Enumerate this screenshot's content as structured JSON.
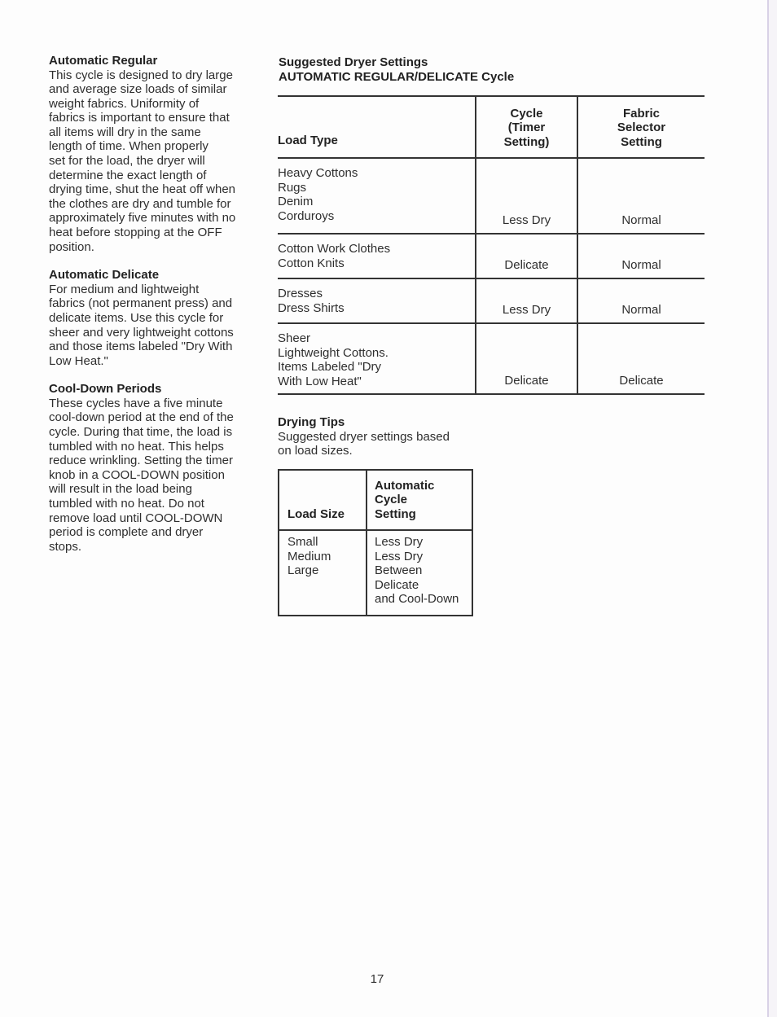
{
  "left_column": {
    "sections": [
      {
        "title": "Automatic Regular",
        "lines": [
          "This cycle is designed to dry large",
          "and average size loads of similar",
          "weight fabrics. Uniformity of",
          "fabrics is important to ensure that",
          "all items will dry in the same",
          "length of time. When properly",
          "set for the load, the dryer will",
          "determine the exact length of",
          "drying time, shut the heat off when",
          "the clothes are dry and tumble for",
          "approximately five minutes with no",
          "heat before stopping at the OFF",
          "position."
        ]
      },
      {
        "title": "Automatic Delicate",
        "lines": [
          "For medium and lightweight",
          "fabrics (not permanent press) and",
          "delicate items. Use this cycle for",
          "sheer and very lightweight cottons",
          "and those items labeled \"Dry With",
          "Low Heat.\""
        ]
      },
      {
        "title": "Cool-Down Periods",
        "lines": [
          "These cycles have a five minute",
          "cool-down period at the end of the",
          "cycle. During that time, the load is",
          "tumbled with no heat. This helps",
          "reduce wrinkling. Setting the timer",
          "knob in a COOL-DOWN position",
          "will result in the load being",
          "tumbled with no heat. Do not",
          "remove load until COOL-DOWN",
          "period is complete and dryer",
          "stops."
        ]
      }
    ]
  },
  "settings": {
    "title": "Suggested Dryer Settings",
    "subtitle": "AUTOMATIC REGULAR/DELICATE Cycle",
    "headers": {
      "load_type": "Load Type",
      "cycle": [
        "Cycle",
        "(Timer",
        "Setting)"
      ],
      "fabric": [
        "Fabric",
        "Selector",
        "Setting"
      ]
    },
    "rows": [
      {
        "load_types": [
          "Heavy Cottons",
          "Rugs",
          "Denim",
          "Corduroys"
        ],
        "cycle": "Less Dry",
        "fabric": "Normal"
      },
      {
        "load_types": [
          "Cotton Work Clothes",
          "Cotton Knits"
        ],
        "cycle": "Delicate",
        "fabric": "Normal"
      },
      {
        "load_types": [
          "Dresses",
          "Dress Shirts"
        ],
        "cycle": "Less Dry",
        "fabric": "Normal"
      },
      {
        "load_types": [
          "Sheer",
          "Lightweight Cottons.",
          "Items Labeled \"Dry",
          "With Low Heat\""
        ],
        "cycle": "Delicate",
        "fabric": "Delicate"
      }
    ]
  },
  "drying_tips": {
    "title": "Drying Tips",
    "subtitle_lines": [
      "Suggested dryer settings based",
      "on load sizes."
    ],
    "headers": {
      "load_size": "Load Size",
      "setting": [
        "Automatic",
        "Cycle",
        "Setting"
      ]
    },
    "load_sizes": [
      "Small",
      "Medium",
      "Large"
    ],
    "settings": [
      "Less Dry",
      "Less Dry",
      "Between",
      "Delicate",
      "and Cool-Down"
    ]
  },
  "page_number": "17"
}
